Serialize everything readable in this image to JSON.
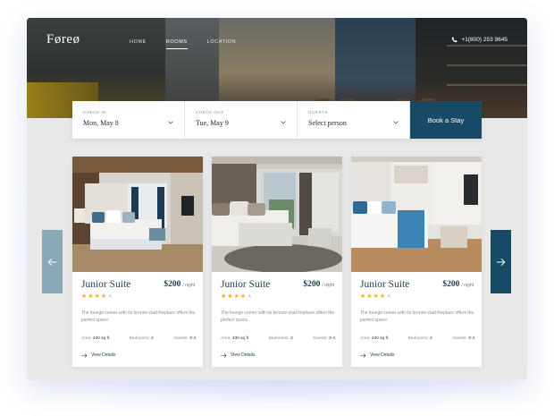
{
  "brand": {
    "logo": "Føreø"
  },
  "nav": {
    "items": [
      {
        "label": "HOME",
        "active": false
      },
      {
        "label": "ROOMS",
        "active": true
      },
      {
        "label": "LOCATION",
        "active": false
      }
    ]
  },
  "contact": {
    "phone": "+1(800) 253 9645",
    "icon": "phone-icon"
  },
  "booking": {
    "check_in": {
      "label": "CHECK IN",
      "value": "Mon, May 8"
    },
    "check_out": {
      "label": "CHECK OUT",
      "value": "Tue, May 9"
    },
    "guests": {
      "label": "GUESTS",
      "value": "Select person"
    },
    "button": "Book a Stay"
  },
  "carousel": {
    "prev_icon": "arrow-left-icon",
    "next_icon": "arrow-right-icon"
  },
  "rooms": [
    {
      "title": "Junior Suite",
      "price": "$200",
      "per": "/ night",
      "rating": 4,
      "max_rating": 5,
      "description": "The lounge corner with its bronze-clad fireplace offers the perfect space.",
      "area_label": "Area:",
      "area": "430 sq ft",
      "bedrooms_label": "Bedrooms:",
      "bedrooms": "2",
      "guests_label": "Guests:",
      "guests": "3-4",
      "details": "View Details"
    },
    {
      "title": "Junior Suite",
      "price": "$200",
      "per": "/ night",
      "rating": 4,
      "max_rating": 5,
      "description": "The lounge corner with its bronze-clad fireplace offers the perfect space.",
      "area_label": "Area:",
      "area": "430 sq ft",
      "bedrooms_label": "Bedrooms:",
      "bedrooms": "2",
      "guests_label": "Guests:",
      "guests": "3-4",
      "details": "View Details"
    },
    {
      "title": "Junior Suite",
      "price": "$200",
      "per": "/ night",
      "rating": 4,
      "max_rating": 5,
      "description": "The lounge corner with its bronze-clad fireplace offers the perfect space.",
      "area_label": "Area:",
      "area": "430 sq ft",
      "bedrooms_label": "Bedrooms:",
      "bedrooms": "2",
      "guests_label": "Guests:",
      "guests": "3-4",
      "details": "View Details"
    }
  ],
  "colors": {
    "accent": "#174a64",
    "star": "#f2b01e",
    "arrow_inactive": "#8aa9b8"
  }
}
